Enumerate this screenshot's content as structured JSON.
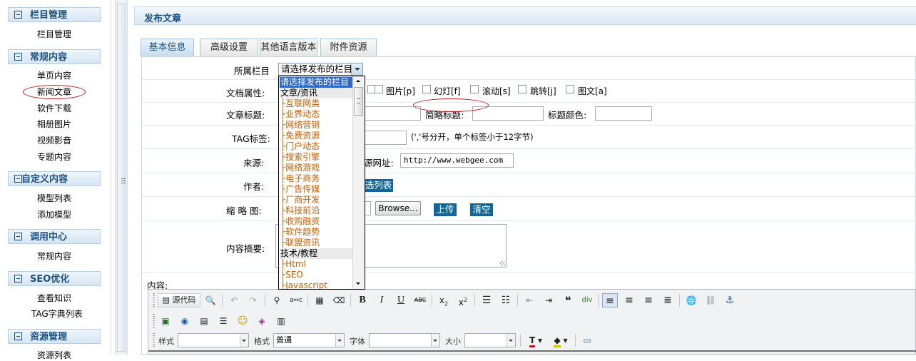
{
  "sidebar": {
    "sections": [
      {
        "title": "栏目管理",
        "items": [
          "栏目管理"
        ]
      },
      {
        "title": "常规内容",
        "items": [
          "单页内容",
          "新闻文章",
          "软件下载",
          "相册图片",
          "视频影音",
          "专题内容"
        ]
      },
      {
        "title": "自定义内容",
        "items": [
          "模型列表",
          "添加模型"
        ]
      },
      {
        "title": "调用中心",
        "items": [
          "常规内容"
        ]
      },
      {
        "title": "SEO优化",
        "items": [
          "查看知识",
          "TAG字典列表"
        ]
      },
      {
        "title": "资源管理",
        "items": [
          "资源列表"
        ]
      }
    ]
  },
  "page": {
    "title": "发布文章"
  },
  "tabs": [
    "基本信息",
    "高级设置",
    "其他语言版本",
    "附件资源"
  ],
  "form": {
    "category": {
      "label": "所属栏目",
      "selected": "请选择发布的栏目"
    },
    "doc_attr": {
      "label": "文档属性:",
      "options": [
        "图片[p]",
        "幻灯[f]",
        "滚动[s]",
        "跳转[j]",
        "图文[a]"
      ]
    },
    "title": {
      "label": "文章标题:",
      "short_label": "简略标题:",
      "color_label": "标题颜色:"
    },
    "tag": {
      "label": "TAG标签:",
      "hint": "(','号分开，单个标签小于12字节)"
    },
    "source": {
      "label": "来源:",
      "url_label_partial": "源网址:",
      "url_value": "http://www.webgee.com"
    },
    "author": {
      "label": "作者:",
      "select_list_partial": "选列表"
    },
    "thumb": {
      "label": "缩 略 图:",
      "browse": "Browse...",
      "upload": "上传",
      "clear": "清空"
    },
    "summary": {
      "label": "内容摘要:"
    },
    "content": {
      "label": "内容:"
    }
  },
  "dropdown": {
    "options": [
      {
        "text": "请选择发布的栏目",
        "kind": "selected"
      },
      {
        "text": "文章/资讯",
        "kind": "group"
      },
      {
        "text": "├互联网类",
        "kind": "child"
      },
      {
        "text": "├业界动态",
        "kind": "child"
      },
      {
        "text": "├网络营销",
        "kind": "child"
      },
      {
        "text": "├免费资源",
        "kind": "child"
      },
      {
        "text": "├门户动态",
        "kind": "child"
      },
      {
        "text": "├搜索引擎",
        "kind": "child"
      },
      {
        "text": "├网络游戏",
        "kind": "child"
      },
      {
        "text": "├电子商务",
        "kind": "child"
      },
      {
        "text": "├广告传媒",
        "kind": "child"
      },
      {
        "text": "├厂商开发",
        "kind": "child"
      },
      {
        "text": "├科技前沿",
        "kind": "child"
      },
      {
        "text": "├收购融资",
        "kind": "child"
      },
      {
        "text": "├软件趋势",
        "kind": "child"
      },
      {
        "text": "├联盟资讯",
        "kind": "child"
      },
      {
        "text": "技术/教程",
        "kind": "group"
      },
      {
        "text": "├Html",
        "kind": "child"
      },
      {
        "text": "├SEO",
        "kind": "child"
      },
      {
        "text": "├Javascript",
        "kind": "child"
      }
    ]
  },
  "editor": {
    "source_label": "源代码",
    "style_label": "样式",
    "format_label": "格式",
    "format_value": "普通",
    "font_label": "字体",
    "size_label": "大小",
    "icons_row1": [
      "source-code",
      "preview",
      "undo",
      "redo",
      "find",
      "replace",
      "select-all",
      "remove-format",
      "bold",
      "italic",
      "underline",
      "strike",
      "subscript",
      "superscript",
      "ordered-list",
      "unordered-list",
      "outdent",
      "indent",
      "blockquote",
      "create-div",
      "align-left",
      "align-center",
      "align-right",
      "align-justify",
      "link",
      "unlink",
      "anchor"
    ],
    "icons_row2": [
      "image",
      "flash",
      "table",
      "horizontal-rule",
      "smiley",
      "special-char",
      "page-break"
    ],
    "icons_row3": [
      "text-color",
      "bg-color",
      "maximize"
    ]
  },
  "colors": {
    "brand_blue": "#12679a",
    "header_text": "#1c4f7c",
    "option_orange": "#c75c00",
    "highlight": "#3169c6",
    "annotation_red": "#c0171d"
  }
}
